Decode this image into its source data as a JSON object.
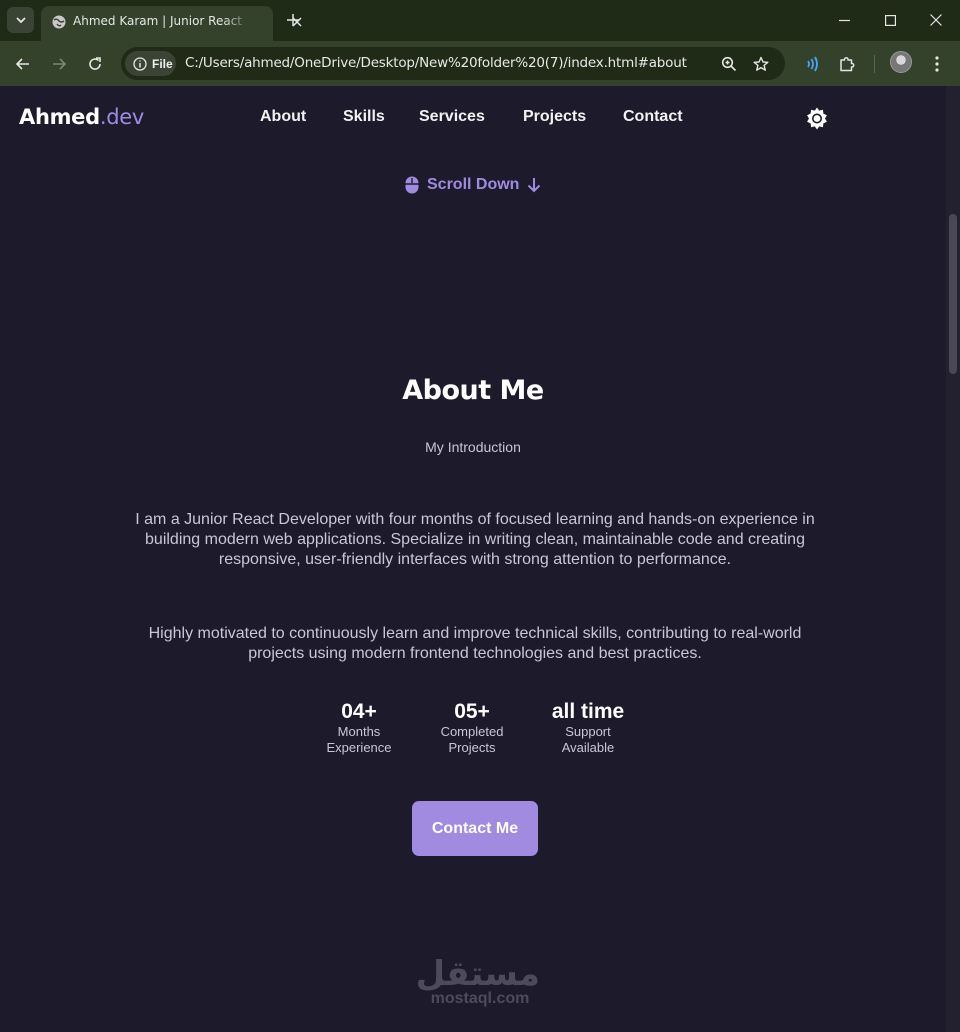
{
  "browser": {
    "tab_title": "Ahmed Karam | Junior React Developer",
    "site_chip": "File",
    "url": "C:/Users/ahmed/OneDrive/Desktop/New%20folder%20(7)/index.html#about"
  },
  "header": {
    "brand_name": "Ahmed",
    "brand_accent": ".dev",
    "nav": [
      "About",
      "Skills",
      "Services",
      "Projects",
      "Contact"
    ]
  },
  "hero": {
    "scroll_down": "Scroll Down"
  },
  "about": {
    "title": "About Me",
    "subtitle": "My Introduction",
    "paragraph1": "I am a Junior React Developer with four months of focused learning and hands-on experience in building modern web applications. Specialize in writing clean, maintainable code and creating responsive, user-friendly interfaces with strong attention to performance.",
    "paragraph2": "Highly motivated to continuously learn and improve technical skills, contributing to real-world projects using modern frontend technologies and best practices.",
    "stats": [
      {
        "number": "04+",
        "label1": "Months",
        "label2": "Experience"
      },
      {
        "number": "05+",
        "label1": "Completed",
        "label2": "Projects"
      },
      {
        "number": "all time",
        "label1": "Support",
        "label2": "Available"
      }
    ],
    "contact_button": "Contact Me"
  },
  "watermark": {
    "arabic": "مستقل",
    "latin": "mostaql.com"
  },
  "colors": {
    "accent": "#a08be0",
    "background": "#1c1a2b",
    "text_muted": "#c9c7d6"
  }
}
